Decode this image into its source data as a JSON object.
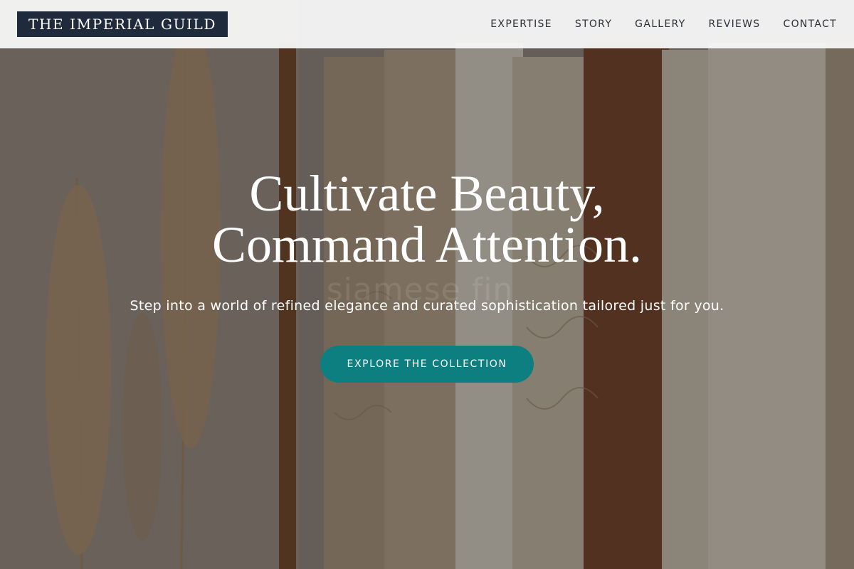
{
  "navbar": {
    "brand": "THE IMPERIAL GUILD",
    "links": [
      {
        "label": "EXPERTISE"
      },
      {
        "label": "STORY"
      },
      {
        "label": "GALLERY"
      },
      {
        "label": "REVIEWS"
      },
      {
        "label": "CONTACT"
      }
    ]
  },
  "hero": {
    "title_line1": "Cultivate Beauty,",
    "title_line2": "Command Attention.",
    "subtitle": "Step into a world of refined elegance and curated sophistication tailored just for you.",
    "cta_label": "EXPLORE THE COLLECTION",
    "watermark": "siamese fin"
  },
  "colors": {
    "brand_bg": "#1f2a3d",
    "accent": "#0e7f80",
    "navbar_bg": "#f6f6f6"
  }
}
